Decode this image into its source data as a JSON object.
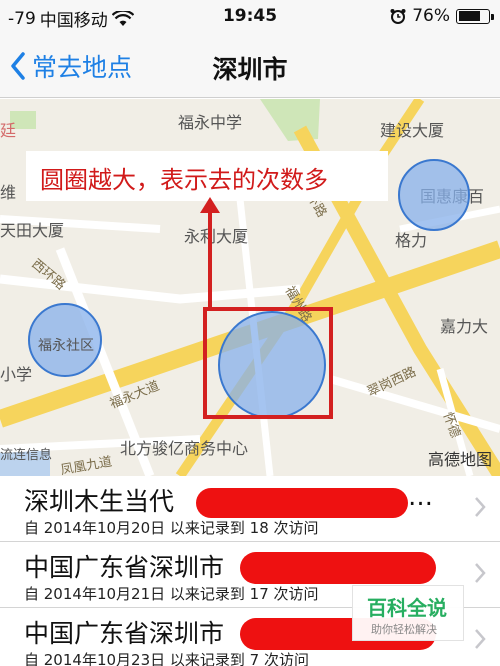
{
  "status_bar": {
    "signal": "-79",
    "carrier": "中国移动",
    "time": "19:45",
    "battery": "76%",
    "battery_level": 0.76
  },
  "nav": {
    "back_label": "常去地点",
    "title": "深圳市"
  },
  "map": {
    "annotation": "圆圈越大，表示去的次数多",
    "attribution": "高德地图",
    "labels": {
      "fuyong_school": "福永中学",
      "jianshe": "建设大厦",
      "guohui": "国惠康百",
      "geli": "格力",
      "yonglidasha": "永利大厦",
      "tiandasha": "天田大厦",
      "jialida": "嘉力大",
      "fuyong_community": "福永社区",
      "xiao": "小学",
      "beifang": "北方骏亿商务中心",
      "fuyong_road": "福永大道",
      "cuigang_road": "翠岗西路",
      "xihuan_road": "西环路",
      "fuyong_road2": "福州路",
      "huaide": "怀德",
      "beihuan": "北环路",
      "liyi": "凤凰九道",
      "wei": "维",
      "ting": "廷",
      "liuli": "流连信息"
    },
    "circle_color": "#87b0eb",
    "annotation_color": "#d11a1a"
  },
  "places": [
    {
      "title": "深圳木生当代",
      "subtitle": "自 2014年10月20日 以来记录到 18 次访问",
      "redacted_suffix": "…"
    },
    {
      "title": "中国广东省深圳市",
      "subtitle": "自 2014年10月21日 以来记录到 17 次访问"
    },
    {
      "title": "中国广东省深圳市",
      "subtitle": "自 2014年10月23日 以来记录到 7 次访问"
    }
  ],
  "watermark": {
    "brand": "百科全说",
    "tagline": "助你轻松解决"
  }
}
